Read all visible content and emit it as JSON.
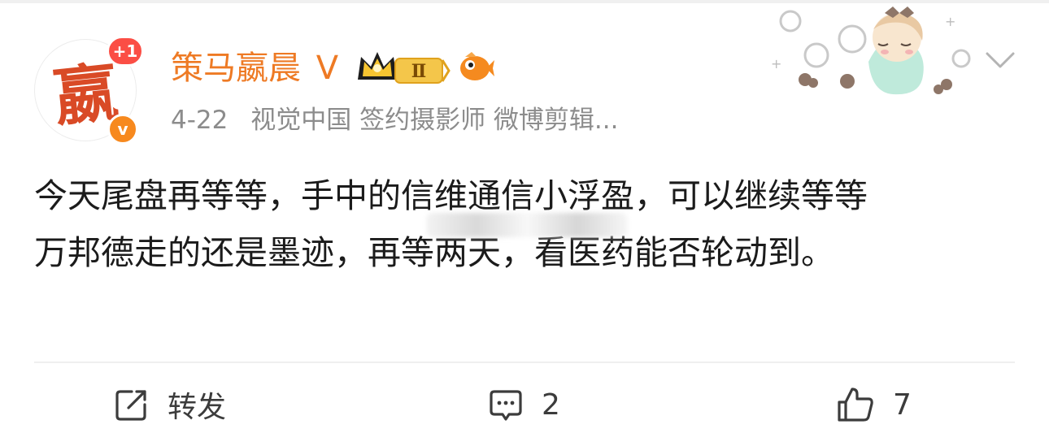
{
  "avatar": {
    "glyph": "嬴",
    "notification_badge": "+1",
    "verified_mark": "v"
  },
  "user": {
    "name": "策马嬴晨",
    "level_letter": "V",
    "vip_level": "Ⅱ"
  },
  "meta": {
    "date": "4-22",
    "source": "视觉中国 签约摄影师 微博剪辑..."
  },
  "post": {
    "lines": [
      "今天尾盘再等等，手中的信维通信小浮盈，可以继续等等",
      "万邦德走的还是墨迹，再等两天，看医药能否轮动到。"
    ]
  },
  "actions": {
    "repost_label": "转发",
    "comment_count": "2",
    "like_count": "7"
  },
  "icons": {
    "repost": "share-edit-icon",
    "comment": "comment-bubble-icon",
    "like": "thumbs-up-icon",
    "more": "chevron-down-icon"
  },
  "colors": {
    "username": "#ee7a24",
    "meta": "#8c8c8c",
    "badge_red": "#fb4e45",
    "verify_orange": "#f7891e"
  }
}
